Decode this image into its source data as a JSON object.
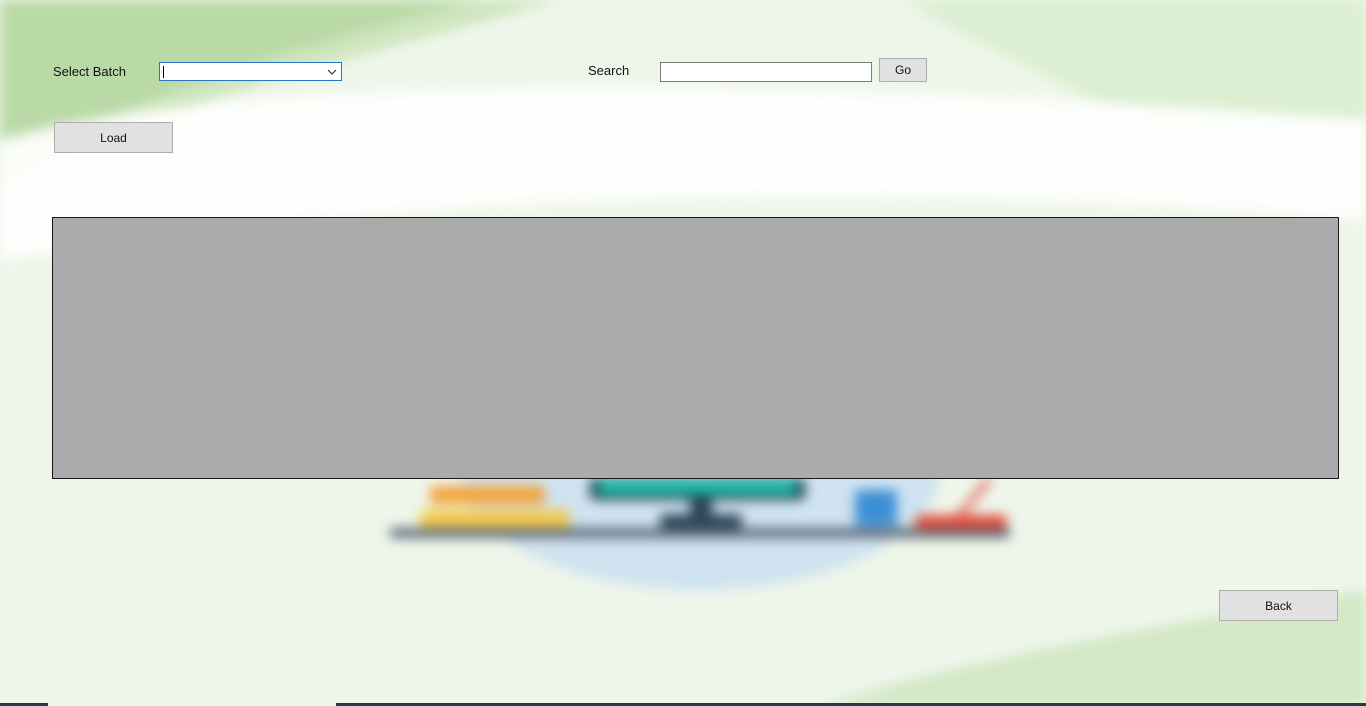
{
  "form": {
    "select_batch_label": "Select Batch",
    "batch_combo_value": "",
    "search_label": "Search",
    "search_value": "",
    "go_label": "Go",
    "load_label": "Load",
    "back_label": "Back"
  },
  "icons": {
    "combo_chevron": "chevron-down-icon"
  },
  "colors": {
    "grid_background": "#ababab",
    "combo_focus_border": "#2a74c9",
    "button_face": "#e1e1e1"
  }
}
